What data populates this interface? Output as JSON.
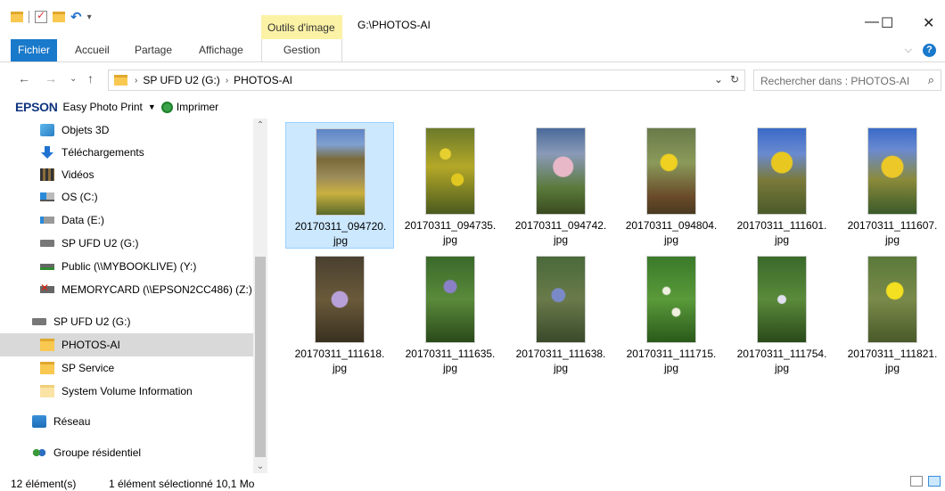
{
  "titlebar": {
    "contextual_tab": "Outils d'image",
    "path_title": "G:\\PHOTOS-AI",
    "minimize": "—",
    "maximize": "☐",
    "close": "✕"
  },
  "ribbon": {
    "tabs": [
      "Fichier",
      "Accueil",
      "Partage",
      "Affichage",
      "Gestion"
    ],
    "expand": "⌵",
    "help": "?"
  },
  "address": {
    "breadcrumbs": [
      "SP UFD U2 (G:)",
      "PHOTOS-AI"
    ],
    "search_placeholder": "Rechercher dans : PHOTOS-AI"
  },
  "epson": {
    "brand": "EPSON",
    "app": "Easy Photo Print",
    "print": "Imprimer"
  },
  "nav_items": [
    {
      "label": "Objets 3D",
      "icon": "cube-icon"
    },
    {
      "label": "Téléchargements",
      "icon": "download-icon"
    },
    {
      "label": "Vidéos",
      "icon": "video-icon"
    },
    {
      "label": "OS (C:)",
      "icon": "os-drive-icon"
    },
    {
      "label": "Data (E:)",
      "icon": "drive-icon"
    },
    {
      "label": "SP UFD U2 (G:)",
      "icon": "usb-drive-icon"
    },
    {
      "label": "Public (\\\\MYBOOKLIVE) (Y:)",
      "icon": "network-drive-icon"
    },
    {
      "label": "MEMORYCARD (\\\\EPSON2CC486) (Z:)",
      "icon": "disconnected-drive-icon"
    },
    {
      "label": "SP UFD U2 (G:)",
      "icon": "usb-drive-icon"
    },
    {
      "label": "PHOTOS-AI",
      "icon": "folder-icon"
    },
    {
      "label": "SP Service",
      "icon": "folder-icon"
    },
    {
      "label": "System Volume Information",
      "icon": "folder-icon"
    },
    {
      "label": "Réseau",
      "icon": "network-icon"
    },
    {
      "label": "Groupe résidentiel",
      "icon": "homegroup-icon"
    }
  ],
  "files": [
    {
      "line1": "20170311_094720.",
      "line2": "jpg",
      "selected": true
    },
    {
      "line1": "20170311_094735.",
      "line2": "jpg"
    },
    {
      "line1": "20170311_094742.",
      "line2": "jpg"
    },
    {
      "line1": "20170311_094804.",
      "line2": "jpg"
    },
    {
      "line1": "20170311_111601.",
      "line2": "jpg"
    },
    {
      "line1": "20170311_111607.",
      "line2": "jpg"
    },
    {
      "line1": "20170311_111618.",
      "line2": "jpg"
    },
    {
      "line1": "20170311_111635.",
      "line2": "jpg"
    },
    {
      "line1": "20170311_111638.",
      "line2": "jpg"
    },
    {
      "line1": "20170311_111715.",
      "line2": "jpg"
    },
    {
      "line1": "20170311_111754.",
      "line2": "jpg"
    },
    {
      "line1": "20170311_111821.",
      "line2": "jpg"
    }
  ],
  "status": {
    "count": "12 élément(s)",
    "selection": "1 élément sélectionné 10,1 Mo"
  },
  "colors": {
    "accent": "#1979ca",
    "selection": "#cce8ff",
    "contextual_tab": "#fbf2a6"
  }
}
